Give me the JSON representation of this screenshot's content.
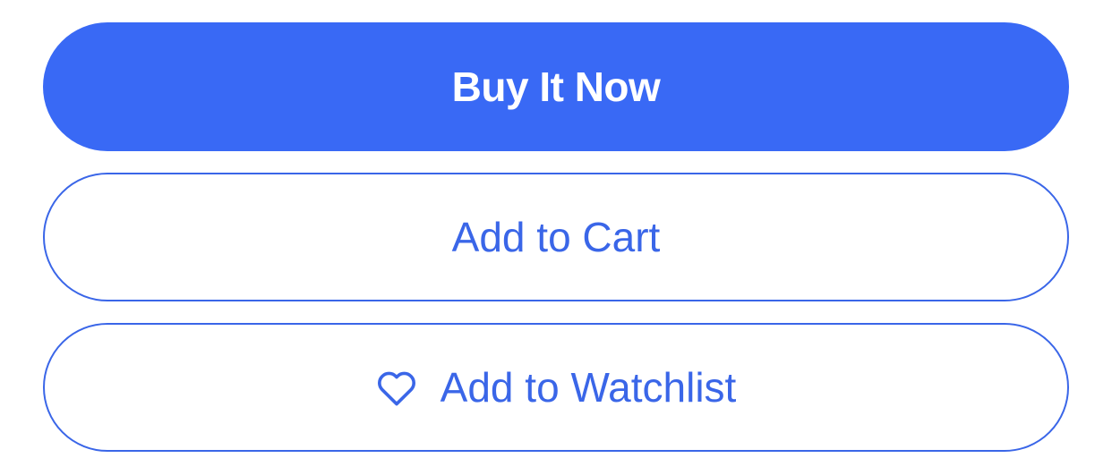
{
  "actions": {
    "buy_now_label": "Buy It Now",
    "add_to_cart_label": "Add to Cart",
    "add_to_watchlist_label": "Add to Watchlist",
    "watchlist_icon": "heart-outline-icon"
  },
  "colors": {
    "primary": "#3969f5",
    "outline": "#3a66e8",
    "background": "#ffffff"
  }
}
